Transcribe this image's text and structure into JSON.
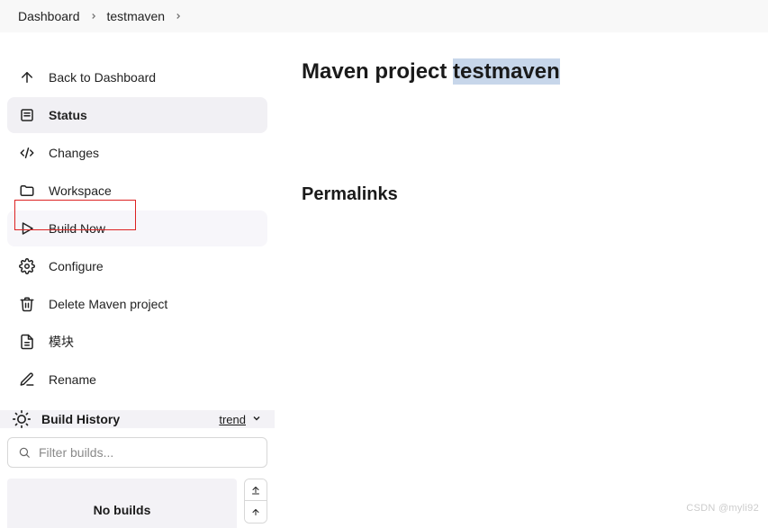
{
  "breadcrumb": {
    "items": [
      "Dashboard",
      "testmaven"
    ]
  },
  "sidebar": {
    "items": [
      {
        "key": "back",
        "label": "Back to Dashboard"
      },
      {
        "key": "status",
        "label": "Status"
      },
      {
        "key": "changes",
        "label": "Changes"
      },
      {
        "key": "workspace",
        "label": "Workspace"
      },
      {
        "key": "build",
        "label": "Build Now"
      },
      {
        "key": "configure",
        "label": "Configure"
      },
      {
        "key": "delete",
        "label": "Delete Maven project"
      },
      {
        "key": "modules",
        "label": "模块"
      },
      {
        "key": "rename",
        "label": "Rename"
      }
    ],
    "active": "status",
    "highlighted": "build"
  },
  "build_history": {
    "title": "Build History",
    "trend_label": "trend",
    "filter_placeholder": "Filter builds...",
    "empty": "No builds"
  },
  "main": {
    "title_prefix": "Maven project ",
    "title_highlight": "testmaven",
    "permalinks_title": "Permalinks"
  },
  "watermark": "CSDN @myli92"
}
